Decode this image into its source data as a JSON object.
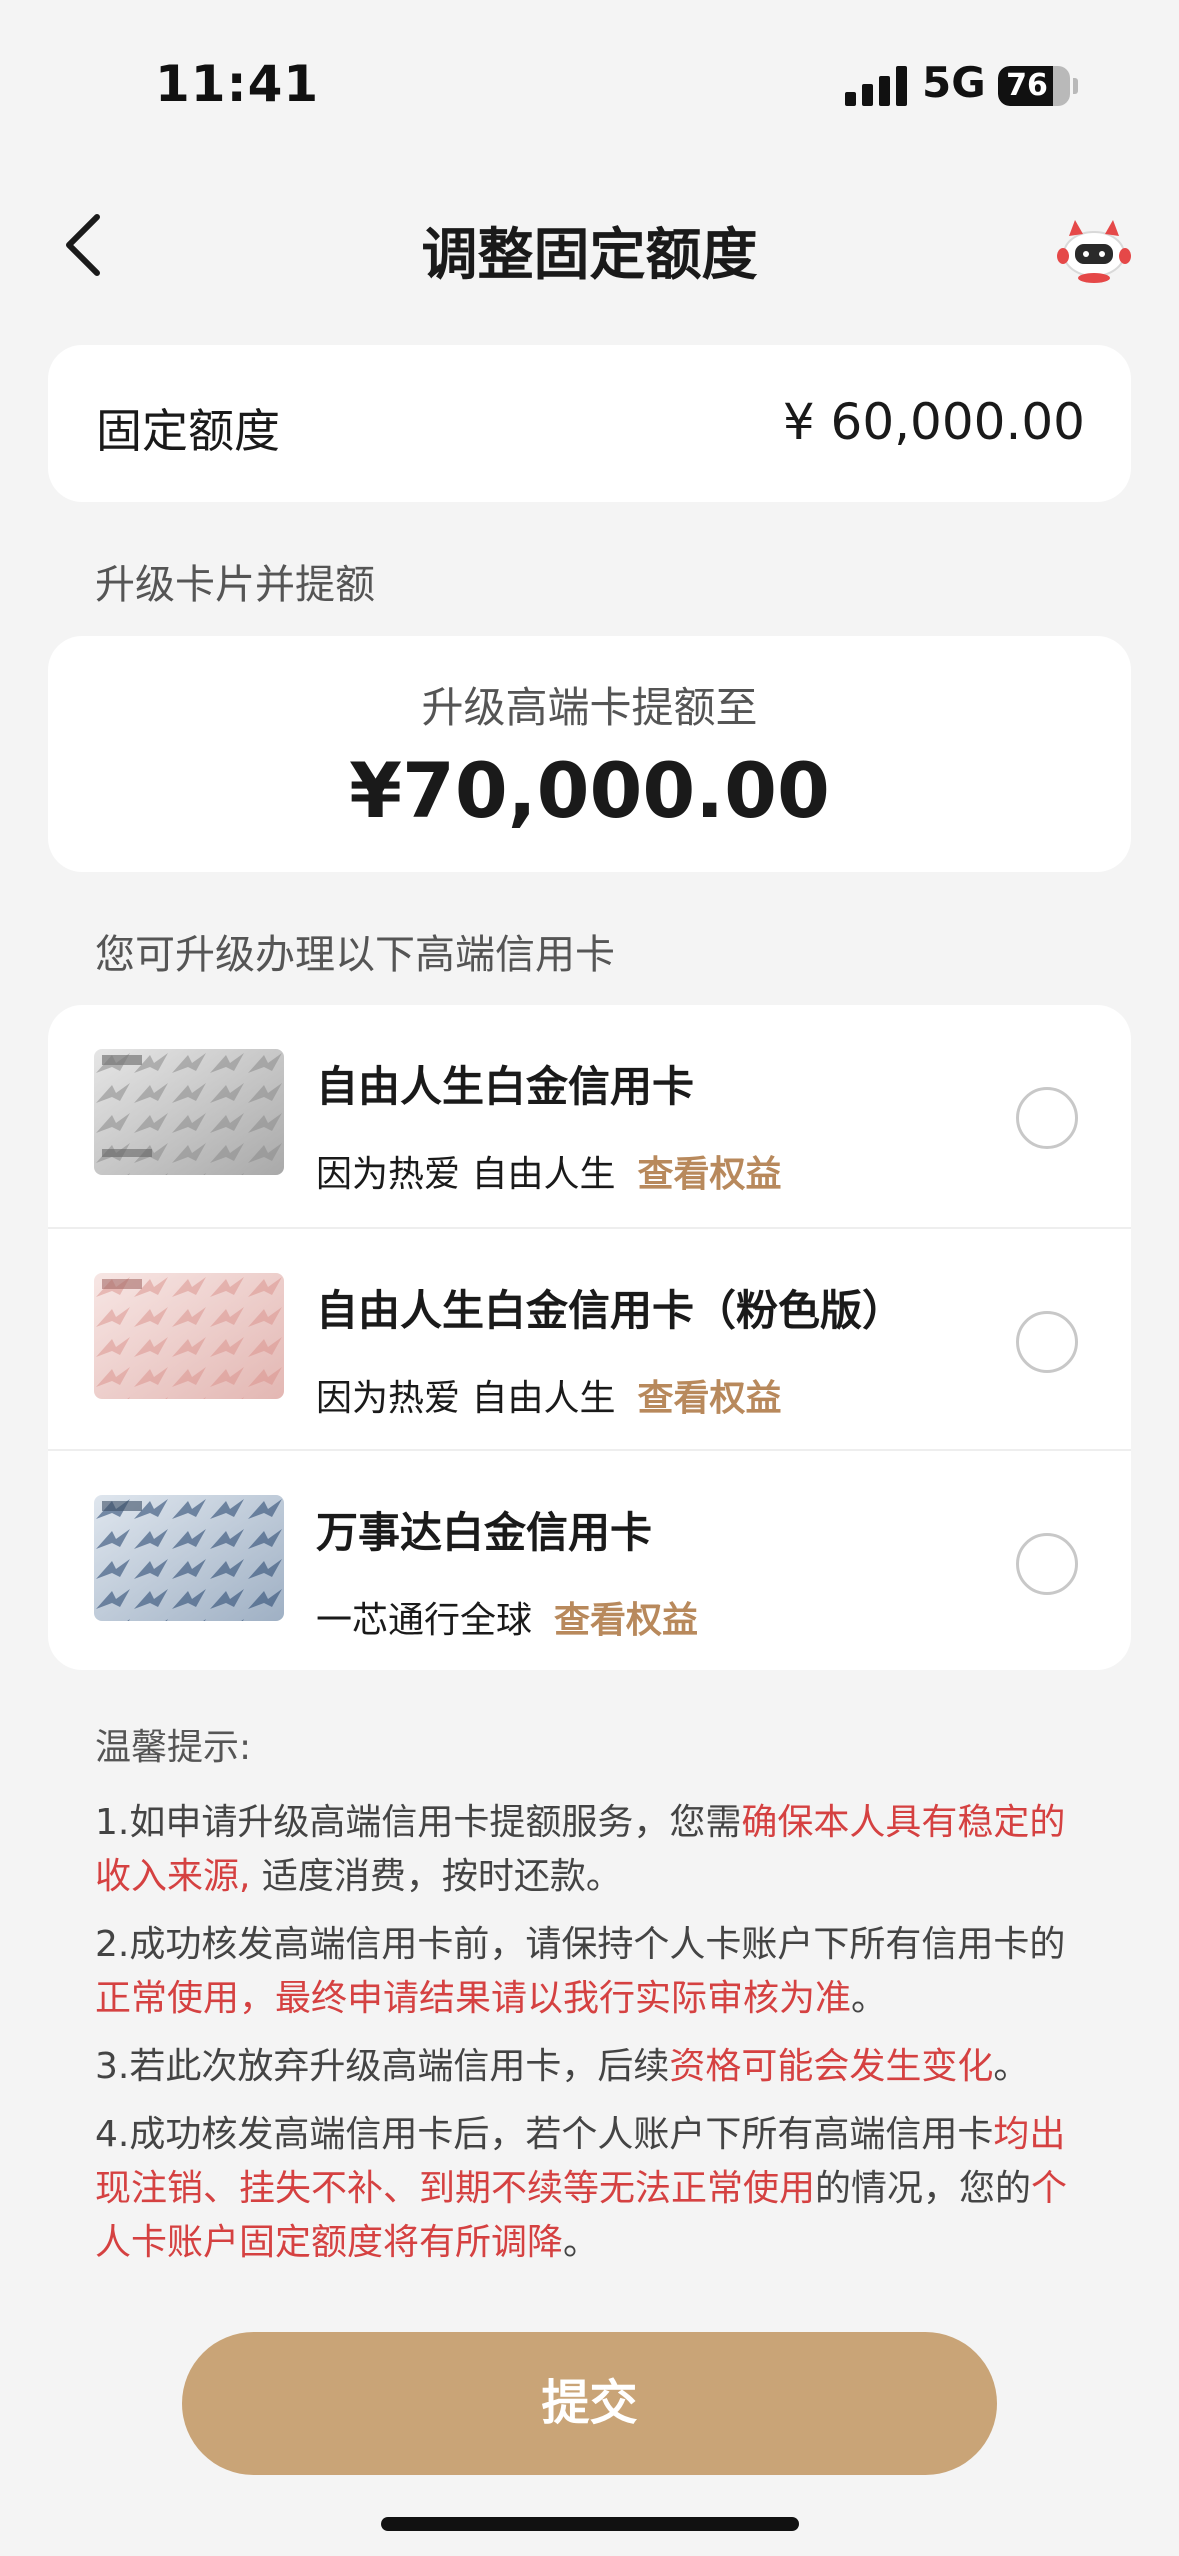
{
  "status_bar": {
    "time": "11:41",
    "network": "5G",
    "battery": "76",
    "battery_level": 0.76
  },
  "nav": {
    "title": "调整固定额度",
    "back_icon": "chevron-left-icon",
    "mascot_icon": "robot-mascot-icon"
  },
  "quota": {
    "label": "固定额度",
    "value": "¥ 60,000.00"
  },
  "upgrade_section": {
    "label": "升级卡片并提额"
  },
  "upgrade_card": {
    "subtitle": "升级高端卡提额至",
    "amount": "¥70,000.00"
  },
  "card_list": {
    "label": "您可升级办理以下高端信用卡",
    "items": [
      {
        "name": "自由人生白金信用卡",
        "desc": "因为热爱 自由人生",
        "link": "查看权益",
        "selected": false,
        "theme": "silver"
      },
      {
        "name": "自由人生白金信用卡（粉色版）",
        "desc": "因为热爱 自由人生",
        "link": "查看权益",
        "selected": false,
        "theme": "pink"
      },
      {
        "name": "万事达白金信用卡",
        "desc": "一芯通行全球",
        "link": "查看权益",
        "selected": false,
        "theme": "blue"
      }
    ]
  },
  "tips": {
    "title": "温馨提示:",
    "items": [
      [
        {
          "text": "1.如申请升级高端信用卡提额服务，您需",
          "red": false
        },
        {
          "text": "确保本人具有稳定的收入来源,",
          "red": true
        },
        {
          "text": " 适度消费，按时还款。",
          "red": false
        }
      ],
      [
        {
          "text": "2.成功核发高端信用卡前，请保持个人卡账户下所有信用卡的",
          "red": false
        },
        {
          "text": "正常使用，最终申请结果请以我行实际审核为准",
          "red": true
        },
        {
          "text": "。",
          "red": false
        }
      ],
      [
        {
          "text": "3.若此次放弃升级高端信用卡，后续",
          "red": false
        },
        {
          "text": "资格可能会发生变化",
          "red": true
        },
        {
          "text": "。",
          "red": false
        }
      ],
      [
        {
          "text": "4.成功核发高端信用卡后，若个人账户下所有高端信用卡",
          "red": false
        },
        {
          "text": "均出现注销、挂失不补、到期不续等无法正常使用",
          "red": true
        },
        {
          "text": "的情况，您的",
          "red": false
        },
        {
          "text": "个人卡账户固定额度将有所调降",
          "red": true
        },
        {
          "text": "。",
          "red": false
        }
      ]
    ]
  },
  "submit": {
    "label": "提交"
  },
  "colors": {
    "accent": "#c9a477",
    "link": "#b8895c",
    "warning": "#d54141",
    "background": "#f4f4f4"
  }
}
